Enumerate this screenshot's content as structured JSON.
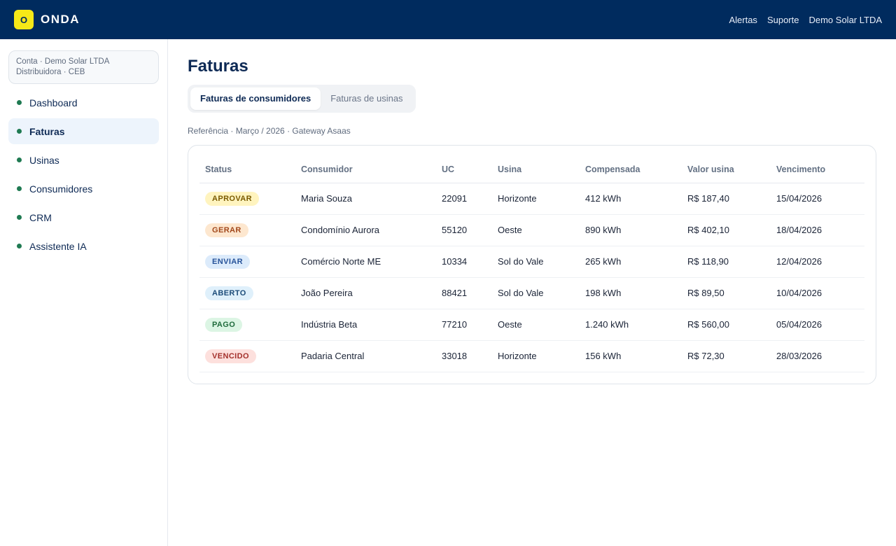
{
  "app": {
    "logo_letter": "O",
    "name": "ONDA"
  },
  "topnav": [
    {
      "label": "Alertas"
    },
    {
      "label": "Suporte"
    },
    {
      "label": "Demo Solar LTDA"
    }
  ],
  "account": {
    "line1": "Conta · Demo Solar LTDA",
    "line2": "Distribuidora · CEB"
  },
  "sidebar": {
    "items": [
      {
        "label": "Dashboard",
        "active": false
      },
      {
        "label": "Faturas",
        "active": true
      },
      {
        "label": "Usinas",
        "active": false
      },
      {
        "label": "Consumidores",
        "active": false
      },
      {
        "label": "CRM",
        "active": false
      },
      {
        "label": "Assistente IA",
        "active": false
      }
    ]
  },
  "page": {
    "title": "Faturas",
    "tabs": [
      {
        "label": "Faturas de consumidores",
        "active": true
      },
      {
        "label": "Faturas de usinas",
        "active": false
      }
    ],
    "reference": "Referência · Março / 2026 · Gateway Asaas"
  },
  "table": {
    "columns": [
      "Status",
      "Consumidor",
      "UC",
      "Usina",
      "Compensada",
      "Valor usina",
      "Vencimento"
    ],
    "rows": [
      {
        "status": "APROVAR",
        "consumidor": "Maria Souza",
        "uc": "22091",
        "usina": "Horizonte",
        "compensada": "412 kWh",
        "valor": "R$ 187,40",
        "vencimento": "15/04/2026"
      },
      {
        "status": "GERAR",
        "consumidor": "Condomínio Aurora",
        "uc": "55120",
        "usina": "Oeste",
        "compensada": "890 kWh",
        "valor": "R$ 402,10",
        "vencimento": "18/04/2026"
      },
      {
        "status": "ENVIAR",
        "consumidor": "Comércio Norte ME",
        "uc": "10334",
        "usina": "Sol do Vale",
        "compensada": "265 kWh",
        "valor": "R$ 118,90",
        "vencimento": "12/04/2026"
      },
      {
        "status": "ABERTO",
        "consumidor": "João Pereira",
        "uc": "88421",
        "usina": "Sol do Vale",
        "compensada": "198 kWh",
        "valor": "R$ 89,50",
        "vencimento": "10/04/2026"
      },
      {
        "status": "PAGO",
        "consumidor": "Indústria Beta",
        "uc": "77210",
        "usina": "Oeste",
        "compensada": "1.240 kWh",
        "valor": "R$ 560,00",
        "vencimento": "05/04/2026"
      },
      {
        "status": "VENCIDO",
        "consumidor": "Padaria Central",
        "uc": "33018",
        "usina": "Horizonte",
        "compensada": "156 kWh",
        "valor": "R$ 72,30",
        "vencimento": "28/03/2026"
      }
    ]
  },
  "colors": {
    "header_bg": "#002b5e",
    "logo_bg": "#f6e918",
    "nav_dot": "#1f7a52",
    "active_nav_bg": "#edf4fc"
  }
}
